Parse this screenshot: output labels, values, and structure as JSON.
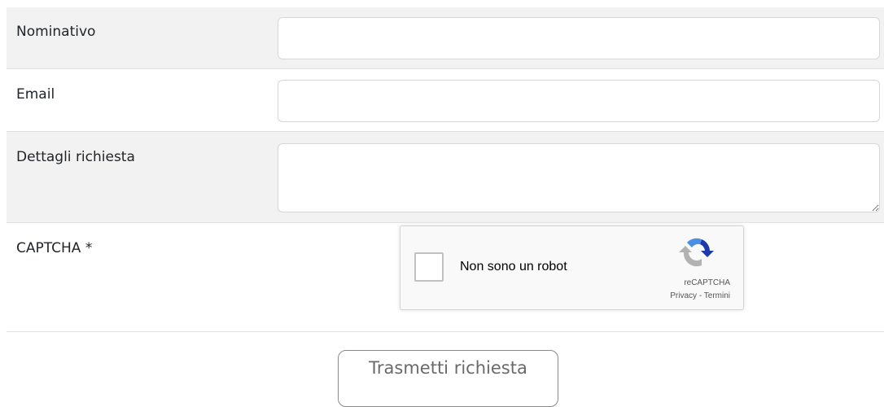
{
  "form": {
    "fields": [
      {
        "label": "Nominativo",
        "value": "",
        "placeholder": ""
      },
      {
        "label": "Email",
        "value": "",
        "placeholder": ""
      },
      {
        "label": "Dettagli richiesta",
        "value": "",
        "placeholder": ""
      }
    ],
    "captcha": {
      "label": "CAPTCHA *",
      "checkbox_text": "Non sono un robot",
      "brand": "reCAPTCHA",
      "privacy": "Privacy",
      "separator": " - ",
      "terms": "Termini",
      "checked": false
    },
    "submit_label": "Trasmetti richiesta"
  },
  "colors": {
    "row_shade": "#f2f2f2",
    "border": "#e2e2e2",
    "captcha_blue": "#4a90e2",
    "captcha_gray": "#b2b2b2"
  }
}
